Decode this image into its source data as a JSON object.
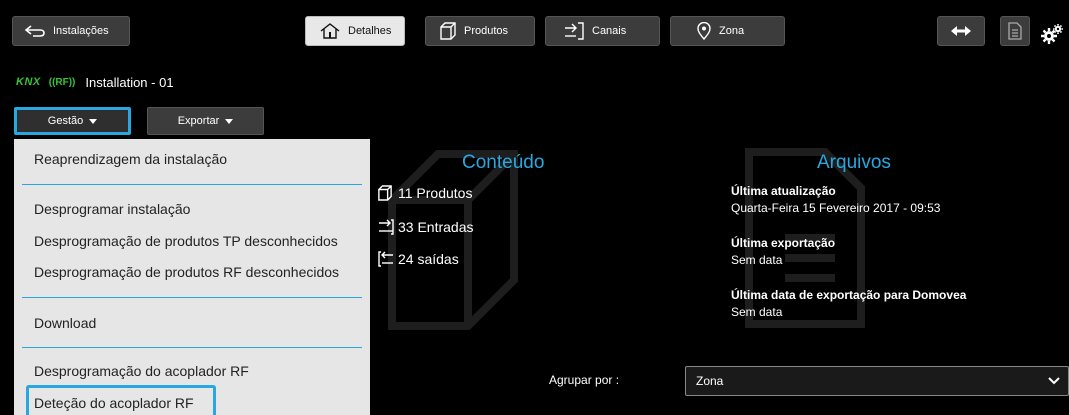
{
  "topbar": {
    "installations_label": "Instalações",
    "tabs": [
      {
        "label": "Detalhes",
        "icon": "home-icon",
        "active": true
      },
      {
        "label": "Produtos",
        "icon": "cube-icon",
        "active": false
      },
      {
        "label": "Canais",
        "icon": "channels-icon",
        "active": false
      },
      {
        "label": "Zona",
        "icon": "location-pin-icon",
        "active": false
      }
    ]
  },
  "installation": {
    "knx_logo": "KNX",
    "rf_logo": "((RF))",
    "name": "Installation - 01"
  },
  "actions": {
    "gestao_label": "Gestão",
    "exportar_label": "Exportar"
  },
  "menu": {
    "items": [
      "Reaprendizagem da instalação",
      "Desprogramar instalação",
      "Desprogramação de produtos TP desconhecidos",
      "Desprogramação de produtos RF desconhecidos",
      "Download",
      "Desprogramação do acoplador RF",
      "Deteção do acoplador RF"
    ]
  },
  "content": {
    "title": "Conteúdo",
    "products": "11 Produtos",
    "inputs": "33 Entradas",
    "outputs": "24 saídas"
  },
  "files": {
    "title": "Arquivos",
    "last_update_label": "Última atualização",
    "last_update_value": "Quarta-Feira 15 Fevereiro 2017 - 09:53",
    "last_export_label": "Última exportação",
    "last_export_value": "Sem data",
    "last_domovea_label": "Última data de exportação para Domovea",
    "last_domovea_value": "Sem data"
  },
  "grouping": {
    "label": "Agrupar por :",
    "selected": "Zona"
  },
  "colors": {
    "accent": "#29a8e0",
    "knx_green": "#38c338",
    "menu_bg": "#e6e6e6"
  }
}
